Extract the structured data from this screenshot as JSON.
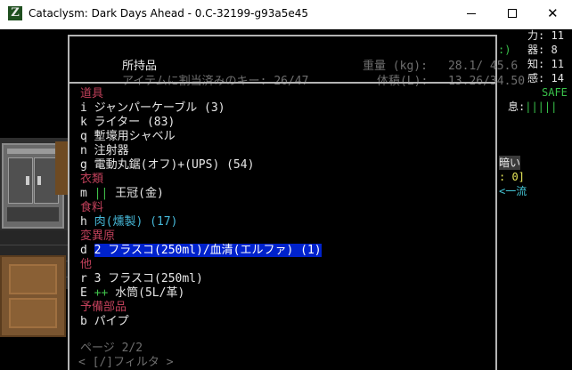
{
  "window": {
    "title": "Cataclysm: Dark Days Ahead - 0.C-32199-g93a5e45",
    "icon_glyph": "Z",
    "minimize_label": "",
    "maximize_label": "",
    "close_label": "✕"
  },
  "inventory": {
    "title": "所持品",
    "assigned_keys_label": "アイテムに割当済みのキー: 26/47",
    "weight_label": "重量 (kg):",
    "weight_value": "28.1/ 45.6",
    "volume_label": "体積(L):",
    "volume_value": "13.26/34.50",
    "rows": [
      {
        "kind": "category",
        "text": "道具"
      },
      {
        "kind": "item",
        "letter": "i",
        "marker": "",
        "name": "ジャンパーケーブル (3)",
        "style": "normal"
      },
      {
        "kind": "item",
        "letter": "k",
        "marker": "",
        "name": "ライター (83)",
        "style": "normal"
      },
      {
        "kind": "item",
        "letter": "q",
        "marker": "",
        "name": "塹壕用シャベル",
        "style": "normal"
      },
      {
        "kind": "item",
        "letter": "n",
        "marker": "",
        "name": "注射器",
        "style": "normal"
      },
      {
        "kind": "item",
        "letter": "g",
        "marker": "",
        "name": "電動丸鋸(オフ)+(UPS) (54)",
        "style": "normal"
      },
      {
        "kind": "category",
        "text": "衣類"
      },
      {
        "kind": "item",
        "letter": "m",
        "marker": "||",
        "name": "王冠(金)",
        "style": "normal"
      },
      {
        "kind": "category",
        "text": "食料"
      },
      {
        "kind": "item",
        "letter": "h",
        "marker": "",
        "name": "肉(燻製) (17)",
        "style": "cyan"
      },
      {
        "kind": "category",
        "text": "変異原"
      },
      {
        "kind": "item",
        "letter": "d",
        "marker": "",
        "name": "2 フラスコ(250ml)/血清(エルファ) (1)",
        "style": "selected"
      },
      {
        "kind": "category",
        "text": "他"
      },
      {
        "kind": "item",
        "letter": "r",
        "marker": "",
        "name": "3 フラスコ(250ml)",
        "style": "normal"
      },
      {
        "kind": "item",
        "letter": "E",
        "marker": "++",
        "name": "水筒(5L/革)",
        "style": "normal"
      },
      {
        "kind": "category",
        "text": "予備部品"
      },
      {
        "kind": "item",
        "letter": "b",
        "marker": "",
        "name": "パイプ",
        "style": "normal"
      }
    ],
    "page_label": "ページ 2/2",
    "filter_label": "< [/]フィルタ >"
  },
  "sidebar": {
    "str_label": "力:",
    "str_value": "11",
    "dex_label": "器:",
    "dex_value": "8",
    "int_label": "知:",
    "int_value": "11",
    "per_label": "感:",
    "per_value": "14",
    "safe_label": "SAFE",
    "focus_label": "息:",
    "focus_bar": "|||||",
    "paren_fragment": ":)",
    "light_label": "暗い",
    "count_fragment": ": 0]",
    "style_fragment": "<一流"
  },
  "colors": {
    "category": "#c0405a",
    "selected_bg": "#0022cc",
    "cyan_text": "#46b8d8",
    "green_text": "#3fc04a",
    "border": "#b4b4b4"
  }
}
